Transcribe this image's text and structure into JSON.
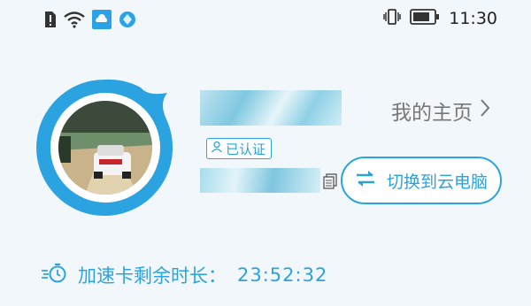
{
  "status_bar": {
    "left_icons": [
      "sim-alert-icon",
      "wifi-icon",
      "cloud-app-icon",
      "browser-app-icon"
    ],
    "right_icons": [
      "vibrate-icon",
      "battery-icon"
    ],
    "time": "11:30"
  },
  "profile": {
    "avatar_icon": "racing-game-avatar",
    "verified_label": "已认证",
    "homepage_label": "我的主页",
    "switch_button_label": "切换到云电脑"
  },
  "accelerator": {
    "label": "加速卡剩余时长：",
    "time_remaining": "23:52:32"
  },
  "colors": {
    "accent": "#2ba3e0",
    "background": "#f2f7fb",
    "muted_text": "#777777"
  }
}
